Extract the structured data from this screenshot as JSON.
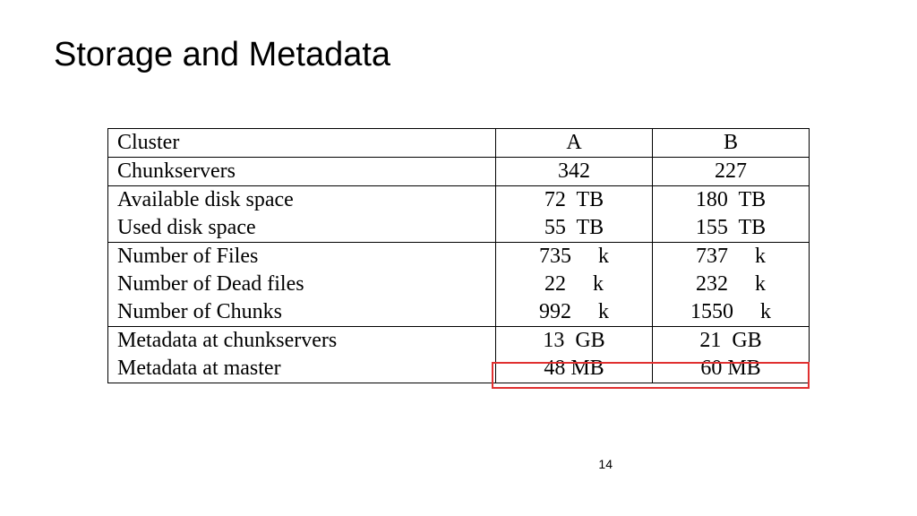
{
  "title": "Storage and Metadata",
  "page_number": "14",
  "chart_data": {
    "type": "table",
    "columns": [
      "Cluster",
      "A",
      "B"
    ],
    "rows": [
      {
        "label": "Chunkservers",
        "a": "342",
        "b": "227"
      },
      {
        "label": "Available disk space",
        "a": "72  TB",
        "b": "180  TB"
      },
      {
        "label": "Used disk space",
        "a": "55  TB",
        "b": "155  TB"
      },
      {
        "label": "Number of Files",
        "a": "735     k",
        "b": "737     k"
      },
      {
        "label": "Number of Dead files",
        "a": "22     k",
        "b": "232     k"
      },
      {
        "label": "Number of Chunks",
        "a": "992     k",
        "b": "1550     k"
      },
      {
        "label": "Metadata at chunkservers",
        "a": "13  GB",
        "b": "21  GB"
      },
      {
        "label": "Metadata at master",
        "a": "48 MB",
        "b": "60 MB"
      }
    ]
  }
}
